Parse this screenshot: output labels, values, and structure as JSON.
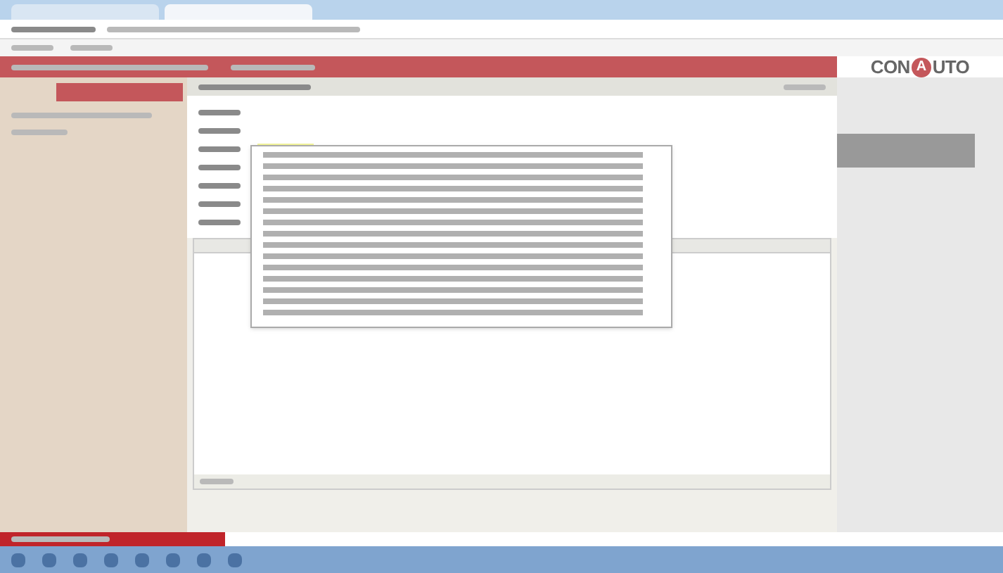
{
  "logo": {
    "left": "CON",
    "mark": "A",
    "right": "UTO"
  },
  "form": {
    "dropdown": {
      "open": true
    }
  }
}
